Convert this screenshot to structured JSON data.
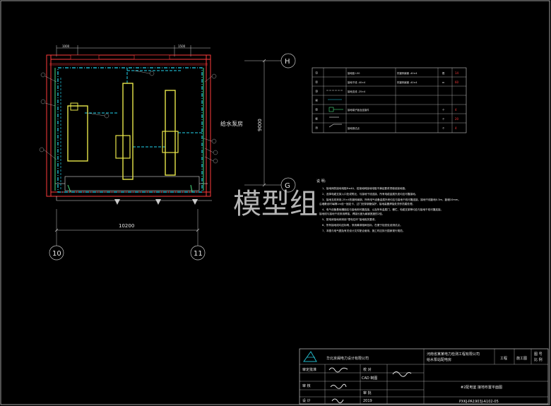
{
  "drawing": {
    "room_label": "给水泵房",
    "watermark": "模型组",
    "dimension_width": "10200",
    "dimension_height": "9000",
    "top_dims": [
      "1000",
      "1500"
    ],
    "axes": {
      "left": "10",
      "right": "11",
      "top": "H",
      "bottom": "G"
    },
    "callouts": [
      "⑦",
      "⑤",
      "③",
      "⑥",
      "⑦",
      "④",
      "⑤",
      "⑥"
    ]
  },
  "legend": {
    "rows": [
      {
        "no": "①",
        "sym": "",
        "name": "接地极 L50",
        "spec": "热镀锌扁钢 -40×4",
        "unit": "根",
        "qty": "14"
      },
      {
        "no": "②",
        "sym": "",
        "name": "接地干线 -40×4",
        "spec": "热镀锌扁钢 -40×4",
        "unit": "m",
        "qty": "60"
      },
      {
        "no": "③",
        "sym": "",
        "name": "接地支线 -25×4",
        "spec": "",
        "unit": "",
        "qty": ""
      },
      {
        "no": "④",
        "sym": "",
        "name": "",
        "spec": "",
        "unit": "",
        "qty": ""
      },
      {
        "no": "⑤",
        "sym": "",
        "name": "接地端子板及连接件",
        "spec": "",
        "unit": "个",
        "qty": "4"
      },
      {
        "no": "⑥",
        "sym": "",
        "name": "",
        "spec": "",
        "unit": "个",
        "qty": "20"
      },
      {
        "no": "⑦",
        "sym": "",
        "name": "接地测试点",
        "spec": "",
        "unit": "个",
        "qty": "4"
      }
    ]
  },
  "notes": {
    "title": "说 明:",
    "lines": [
      "1、接地网的接地电阻R≤4Ω，若接地网接地电阻不满足要求须增设接地极。",
      "2、选择电缆支架入口处或附近，与接地干线连接，所有电缆金属外皮均应可靠接地。",
      "3、接地支线采用-25×4热镀锌扁钢，所有电气设备金属外壳均应与接地干线可靠连接，接地干线距地0.3m，距墙10mm。",
      "   沿墙敷设时每隔1m设一固定卡，过门处穿钢管保护，接地装置焊接处须作防腐处理。",
      "4、电气设备基础槽钢应与接地网可靠连接，以及所有金属门、栅栏、电缆支架等均应与接地干线可靠连接。",
      "   接地线与接地干线采用焊接，焊接长度为扁钢宽度的2倍。",
      "5、配电房接地网采用“零电位环”接地相关要求。",
      "6、所有接地线均应标明，采用黄绿相间色标，在便于检查处设测试点。",
      "7、本图与电气图及有关设计文件配合使用，施工时应执行国家现行规范。"
    ]
  },
  "title_block": {
    "company": "华北京闽电力设计有限公司",
    "client_line1": "河南省某某电力检测工程有限公司",
    "client_line2": "给水泵站配电房",
    "stage_label": "工程",
    "stage_value": "施工图",
    "sheet_label1": "图 号",
    "sheet_label2": "比 例",
    "role1": "审定批准",
    "role2": "审 核",
    "role3": "设 计",
    "cad_label": "CAD 制图",
    "design_label": "校 对",
    "year": "2019",
    "drawing_title": "#2配电室 接地布置平面图",
    "drawing_no": "PXKJ-PA1903J-A102-05",
    "sign_note": "绘 图",
    "verify": "审 批"
  }
}
